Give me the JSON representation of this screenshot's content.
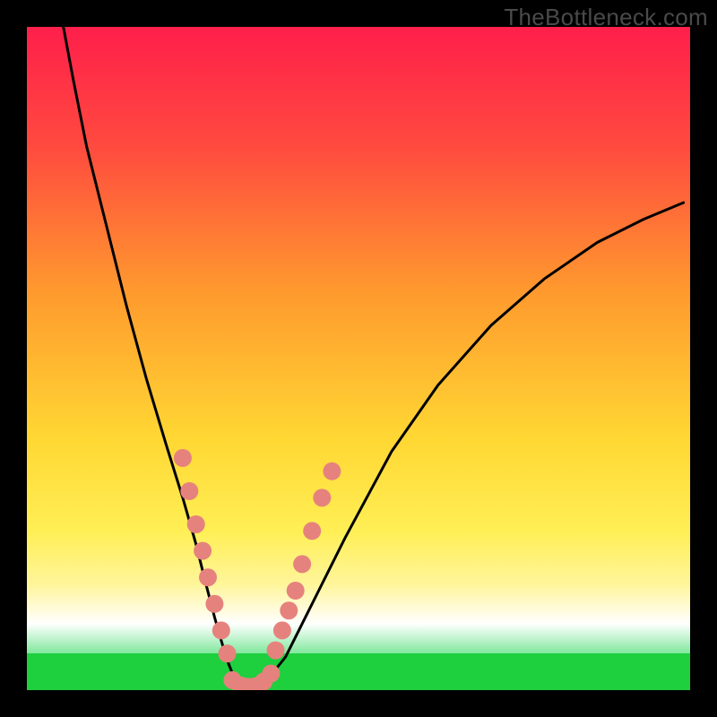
{
  "watermark": "TheBottleneck.com",
  "chart_data": {
    "type": "line",
    "title": "",
    "xlabel": "",
    "ylabel": "",
    "xlim": [
      0,
      100
    ],
    "ylim": [
      0,
      100
    ],
    "gradient_stops": [
      {
        "offset": 0,
        "color": "#ff1f4b"
      },
      {
        "offset": 18,
        "color": "#ff4a3f"
      },
      {
        "offset": 40,
        "color": "#ff9a2e"
      },
      {
        "offset": 62,
        "color": "#ffd733"
      },
      {
        "offset": 76,
        "color": "#ffef55"
      },
      {
        "offset": 84,
        "color": "#fff59a"
      },
      {
        "offset": 90,
        "color": "#ffffff"
      },
      {
        "offset": 96,
        "color": "#55e07a"
      },
      {
        "offset": 100,
        "color": "#28c94b"
      }
    ],
    "green_band": {
      "top_pct": 94.5,
      "height_pct": 5.5,
      "color": "#1ecf3e"
    },
    "series": [
      {
        "name": "curve",
        "x": [
          5.5,
          7,
          9,
          12,
          15,
          18,
          21,
          23.5,
          25.5,
          27,
          28.3,
          29.3,
          30.2,
          31,
          32,
          33.5,
          35,
          37,
          39,
          41,
          44,
          48,
          55,
          62,
          70,
          78,
          86,
          93,
          99
        ],
        "y": [
          100,
          92,
          82,
          70,
          58,
          47,
          37,
          29,
          22,
          16,
          11,
          7.5,
          4.5,
          2.5,
          1,
          0.3,
          0.8,
          2.5,
          5,
          9,
          15,
          23,
          36,
          46,
          55,
          62,
          67.5,
          71,
          73.5
        ]
      }
    ],
    "markers": {
      "left_branch": [
        {
          "x": 23.5,
          "y": 35
        },
        {
          "x": 24.5,
          "y": 30
        },
        {
          "x": 25.5,
          "y": 25
        },
        {
          "x": 26.5,
          "y": 21
        },
        {
          "x": 27.3,
          "y": 17
        },
        {
          "x": 28.3,
          "y": 13
        },
        {
          "x": 29.3,
          "y": 9
        },
        {
          "x": 30.2,
          "y": 5.5
        }
      ],
      "right_branch": [
        {
          "x": 37.5,
          "y": 6
        },
        {
          "x": 38.5,
          "y": 9
        },
        {
          "x": 39.5,
          "y": 12
        },
        {
          "x": 40.5,
          "y": 15
        },
        {
          "x": 41.5,
          "y": 19
        },
        {
          "x": 43,
          "y": 24
        },
        {
          "x": 44.5,
          "y": 29
        },
        {
          "x": 46,
          "y": 33
        }
      ],
      "bottom": [
        {
          "x": 31,
          "y": 1.5
        },
        {
          "x": 32.2,
          "y": 0.7
        },
        {
          "x": 33.3,
          "y": 0.5
        },
        {
          "x": 34.5,
          "y": 0.6
        },
        {
          "x": 35.7,
          "y": 1.3
        },
        {
          "x": 36.8,
          "y": 2.5
        }
      ]
    },
    "marker_radius": 10,
    "curve_stroke": "#000000",
    "curve_width": 3
  }
}
